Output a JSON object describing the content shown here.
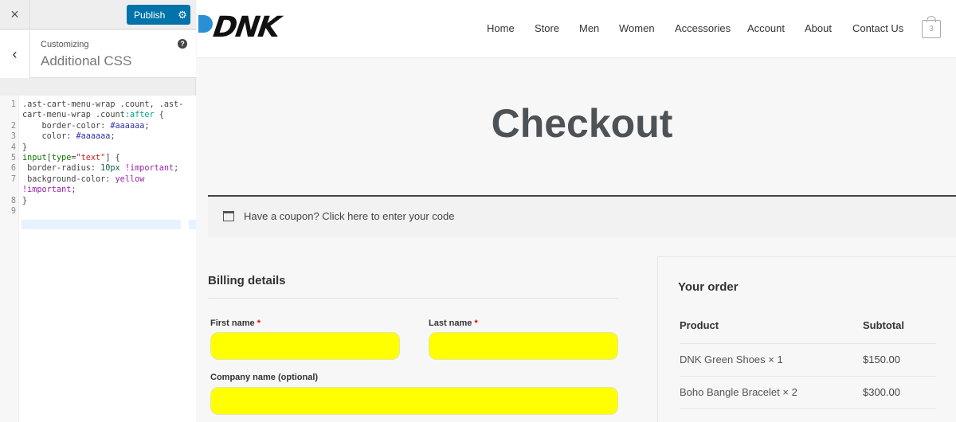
{
  "customizer": {
    "close_icon": "×",
    "publish_label": "Publish",
    "settings_icon": "⚙",
    "back_icon": "‹",
    "section_label": "Customizing",
    "section_title": "Additional CSS",
    "help_icon": "?",
    "code_lines": [
      {
        "num": "1",
        "text": ".ast-cart-menu-wrap .count, .ast-"
      },
      {
        "num": "",
        "text": "cart-menu-wrap .count:after {"
      },
      {
        "num": "2",
        "text": "    border-color: #aaaaaa;"
      },
      {
        "num": "3",
        "text": "    color: #aaaaaa;"
      },
      {
        "num": "4",
        "text": "}"
      },
      {
        "num": "5",
        "text": "input[type=\"text\"] {"
      },
      {
        "num": "6",
        "text": " border-radius: 10px !important;"
      },
      {
        "num": "7",
        "text": " background-color: yellow"
      },
      {
        "num": "",
        "text": "!important;"
      },
      {
        "num": "8",
        "text": "}"
      },
      {
        "num": "9",
        "text": ""
      }
    ]
  },
  "site": {
    "logo": "DNK",
    "nav": [
      "Home",
      "Store",
      "Men",
      "Women",
      "Accessories",
      "Account",
      "About",
      "Contact Us"
    ],
    "cart_count": "3",
    "page_title": "Checkout",
    "coupon_text": "Have a coupon? Click here to enter your code",
    "billing": {
      "title": "Billing details",
      "first_name_label": "First name",
      "last_name_label": "Last name",
      "company_label": "Company name (optional)",
      "required_mark": "*",
      "first_name_value": "",
      "last_name_value": "",
      "company_value": ""
    },
    "order": {
      "title": "Your order",
      "col_product": "Product",
      "col_subtotal": "Subtotal",
      "rows": [
        {
          "product": "DNK Green Shoes  × 1",
          "subtotal": "$150.00"
        },
        {
          "product": "Boho Bangle Bracelet  × 2",
          "subtotal": "$300.00"
        }
      ]
    },
    "colors": {
      "accent": "#0073aa",
      "field_bg": "#ffff00"
    }
  }
}
